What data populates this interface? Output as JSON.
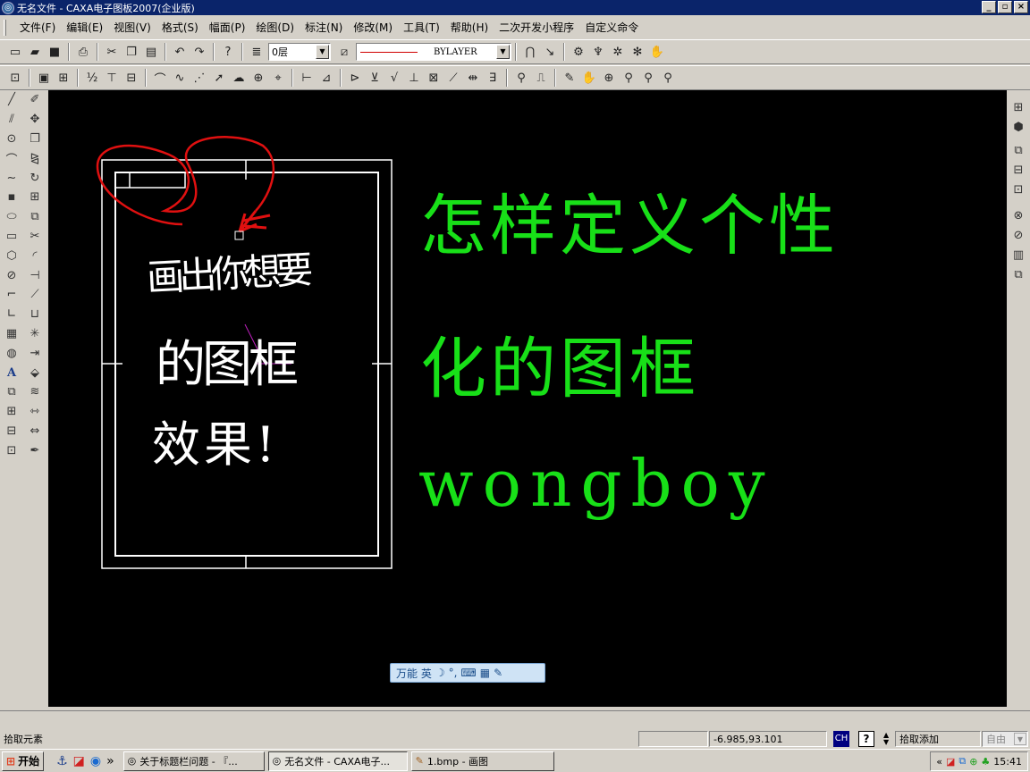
{
  "window": {
    "title": "无名文件 - CAXA电子图板2007(企业版)",
    "controls": [
      "_",
      "▫",
      "×"
    ]
  },
  "menu": [
    "文件(F)",
    "编辑(E)",
    "视图(V)",
    "格式(S)",
    "幅面(P)",
    "绘图(D)",
    "标注(N)",
    "修改(M)",
    "工具(T)",
    "帮助(H)",
    "二次开发小程序",
    "自定义命令"
  ],
  "toolbar": {
    "layer_value": "0层",
    "linetype_value": "BYLAYER"
  },
  "drawing": {
    "handwriting": [
      "画出你想要",
      "的图框",
      "效果!"
    ],
    "heading": [
      "怎样定义个性",
      "化的图框"
    ],
    "signature": "wongboy",
    "heading_color": "#18e018",
    "frame_color": "#ffffff",
    "annotation_color": "#e01010"
  },
  "ime_bar": {
    "label": "万能 英",
    "icons": [
      "moon-icon",
      "punctuation-icon",
      "keyboard-icon",
      "web-icon",
      "wrench-icon"
    ]
  },
  "status": {
    "prompt": "拾取元素",
    "coords": "-6.985,93.101",
    "lang": "CH",
    "help": "?",
    "mode": "拾取添加",
    "option": "自由"
  },
  "taskbar": {
    "start": "开始",
    "tasks": [
      "关于标题栏问题 - 『...",
      "无名文件 - CAXA电子...",
      "1.bmp - 画图"
    ],
    "clock": "15:41"
  }
}
